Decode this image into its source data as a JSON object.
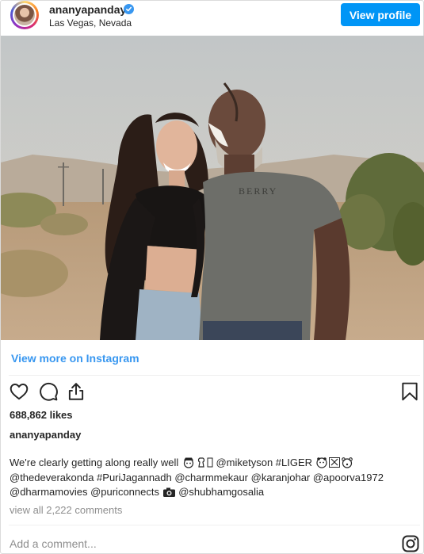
{
  "header": {
    "username": "ananyapanday",
    "location": "Las Vegas, Nevada",
    "view_profile_label": "View profile"
  },
  "post": {
    "view_more_label": "View more on Instagram",
    "likes": "688,862 likes",
    "caption_username": "ananyapanday",
    "caption_line1_text": "We're clearly getting along really well",
    "caption_line1_tail": "@miketyson #LIGER",
    "caption_line2": "@thedeverakonda #PuriJagannadh @charmmekaur @karanjohar @apoorva1972",
    "caption_line3_head": "@dharmamovies @puriconnects",
    "caption_line3_tail": "@shubhamgosalia",
    "comments_link": "view all 2,222 comments"
  },
  "footer": {
    "add_comment_placeholder": "Add a comment..."
  },
  "icons": {
    "verified": "verified-badge-icon",
    "like": "heart-icon",
    "comment": "comment-bubble-icon",
    "share": "share-icon",
    "save": "bookmark-icon",
    "instagram": "instagram-logo-icon"
  },
  "colors": {
    "accent": "#0095f6",
    "link": "#3897f0",
    "muted": "#8e8e8e",
    "text": "#262626"
  }
}
